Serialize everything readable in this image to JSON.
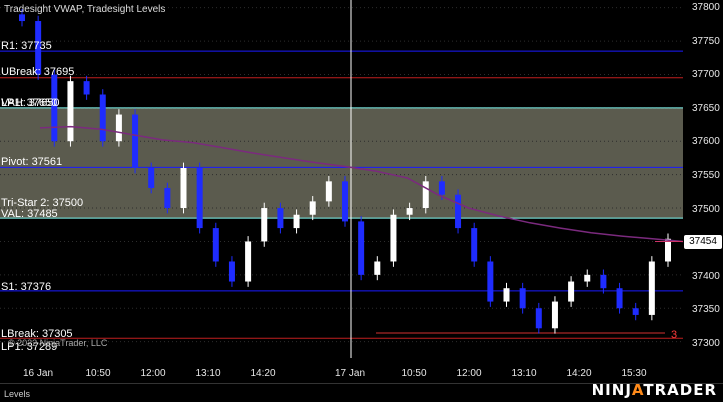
{
  "title": "Tradesight VWAP, Tradesight Levels",
  "copyright": "© 2022 NinjaTrader, LLC",
  "tab_label": "Levels",
  "brand": {
    "left": "NINJ",
    "accent": "A",
    "right": "TRADER"
  },
  "current_price": "37454",
  "count_label": "3",
  "colors": {
    "bull_candle": "#ffffff",
    "bear_candle": "#1f2cff",
    "vwap": "#7b2a7e",
    "value_area": "#6b6b5c",
    "blue_level": "#1a1aff",
    "red_level": "#c01f1f",
    "aqua_level": "#7ff7f0"
  },
  "levels": [
    {
      "label": "R1: 37735",
      "price": 37735,
      "color": "blue"
    },
    {
      "label": "UBreak: 37695",
      "price": 37695,
      "color": "red"
    },
    {
      "label": "VAH: 37650",
      "price": 37650,
      "color": "aqua"
    },
    {
      "label": "LP1: 37650",
      "price": 37650,
      "color": "none"
    },
    {
      "label": "Pivot: 37561",
      "price": 37561,
      "color": "blue"
    },
    {
      "label": "Tri-Star 2: 37500",
      "price": 37500,
      "color": "none"
    },
    {
      "label": "VAL: 37485",
      "price": 37485,
      "color": "aqua"
    },
    {
      "label": "S1: 37376",
      "price": 37376,
      "color": "blue"
    },
    {
      "label": "LBreak: 37305",
      "price": 37305,
      "color": "red"
    },
    {
      "label": "LP1: 37289",
      "price": 37289,
      "color": "none"
    }
  ],
  "y_axis": {
    "min": 37280,
    "max": 37810,
    "ticks": [
      "37800",
      "37750",
      "37700",
      "37650",
      "37600",
      "37550",
      "37500",
      "37450",
      "37400",
      "37350",
      "37300"
    ]
  },
  "x_axis": {
    "labels": [
      "16 Jan",
      "10:50",
      "12:00",
      "13:10",
      "14:20",
      "17 Jan",
      "10:50",
      "12:00",
      "13:10",
      "14:20",
      "15:30"
    ]
  },
  "chart_data": {
    "type": "candlestick",
    "title": "Tradesight VWAP, Tradesight Levels",
    "series": [
      {
        "name": "Tradesight VWAP",
        "values": [
          37620,
          37622,
          37618,
          37610,
          37602,
          37598,
          37590,
          37582,
          37575,
          37568,
          37562,
          37555,
          37545,
          37520,
          37500,
          37488,
          37478,
          37470,
          37463,
          37458,
          37454,
          37450
        ]
      }
    ],
    "close": [
      37780,
      37700,
      37600,
      37690,
      37670,
      37600,
      37640,
      37560,
      37530,
      37500,
      37560,
      37470,
      37420,
      37390,
      37450,
      37500,
      37470,
      37490,
      37510,
      37540,
      37480,
      37400,
      37420,
      37490,
      37500,
      37540,
      37520,
      37470,
      37420,
      37360,
      37380,
      37350,
      37320,
      37360,
      37390,
      37400,
      37380,
      37350,
      37340,
      37420,
      37454
    ]
  }
}
